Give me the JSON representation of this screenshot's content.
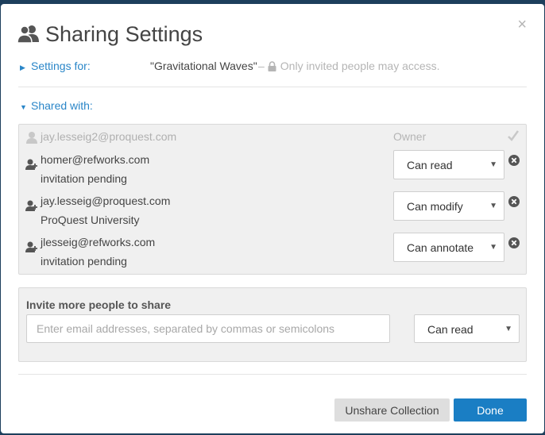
{
  "dialog": {
    "title": "Sharing Settings",
    "close_glyph": "×",
    "icons": {
      "title": "users-icon",
      "close": "close-icon"
    }
  },
  "settings_for": {
    "label": "Settings for:",
    "collection": "\"Gravitational Waves\"",
    "separator": "–",
    "access": "Only invited people may access."
  },
  "shared_with": {
    "label": "Shared with:",
    "owner": {
      "email": "jay.lesseig2@proquest.com",
      "role": "Owner"
    },
    "users": [
      {
        "email": "homer@refworks.com",
        "subtitle": "invitation pending",
        "permission": "Can read"
      },
      {
        "email": "jay.lesseig@proquest.com",
        "subtitle": "ProQuest University",
        "permission": "Can modify"
      },
      {
        "email": "jlesseig@refworks.com",
        "subtitle": "invitation pending",
        "permission": "Can annotate"
      }
    ]
  },
  "invite": {
    "title": "Invite more people to share",
    "placeholder": "Enter email addresses, separated by commas or semicolons",
    "permission": "Can read"
  },
  "buttons": {
    "unshare": "Unshare Collection",
    "done": "Done"
  },
  "colors": {
    "accent": "#1a7ec4",
    "link": "#2a86c8",
    "backdrop": "#1d3f5c"
  }
}
